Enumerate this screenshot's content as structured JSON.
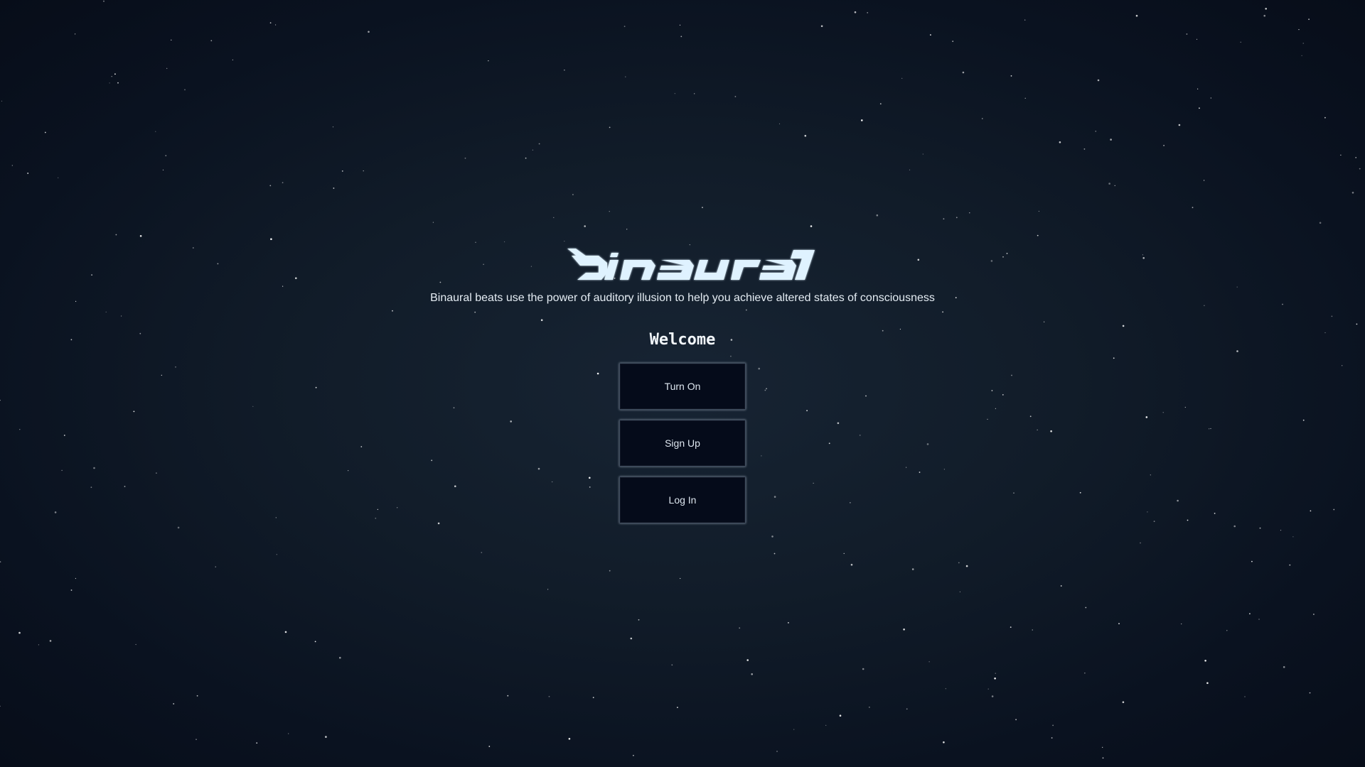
{
  "app": {
    "logo_text": "binaural",
    "tagline": "Binaural beats use the power of auditory illusion to help you achieve altered states of consciousness",
    "welcome": "Welcome"
  },
  "actions": {
    "turn_on_label": "Turn On",
    "sign_up_label": "Sign Up",
    "log_in_label": "Log In"
  },
  "colors": {
    "background": "#0a1220",
    "text": "#e4ecf3",
    "logo": "#dff2ff",
    "button_bg": "#050b1a",
    "button_border": "#3d4a5c"
  }
}
